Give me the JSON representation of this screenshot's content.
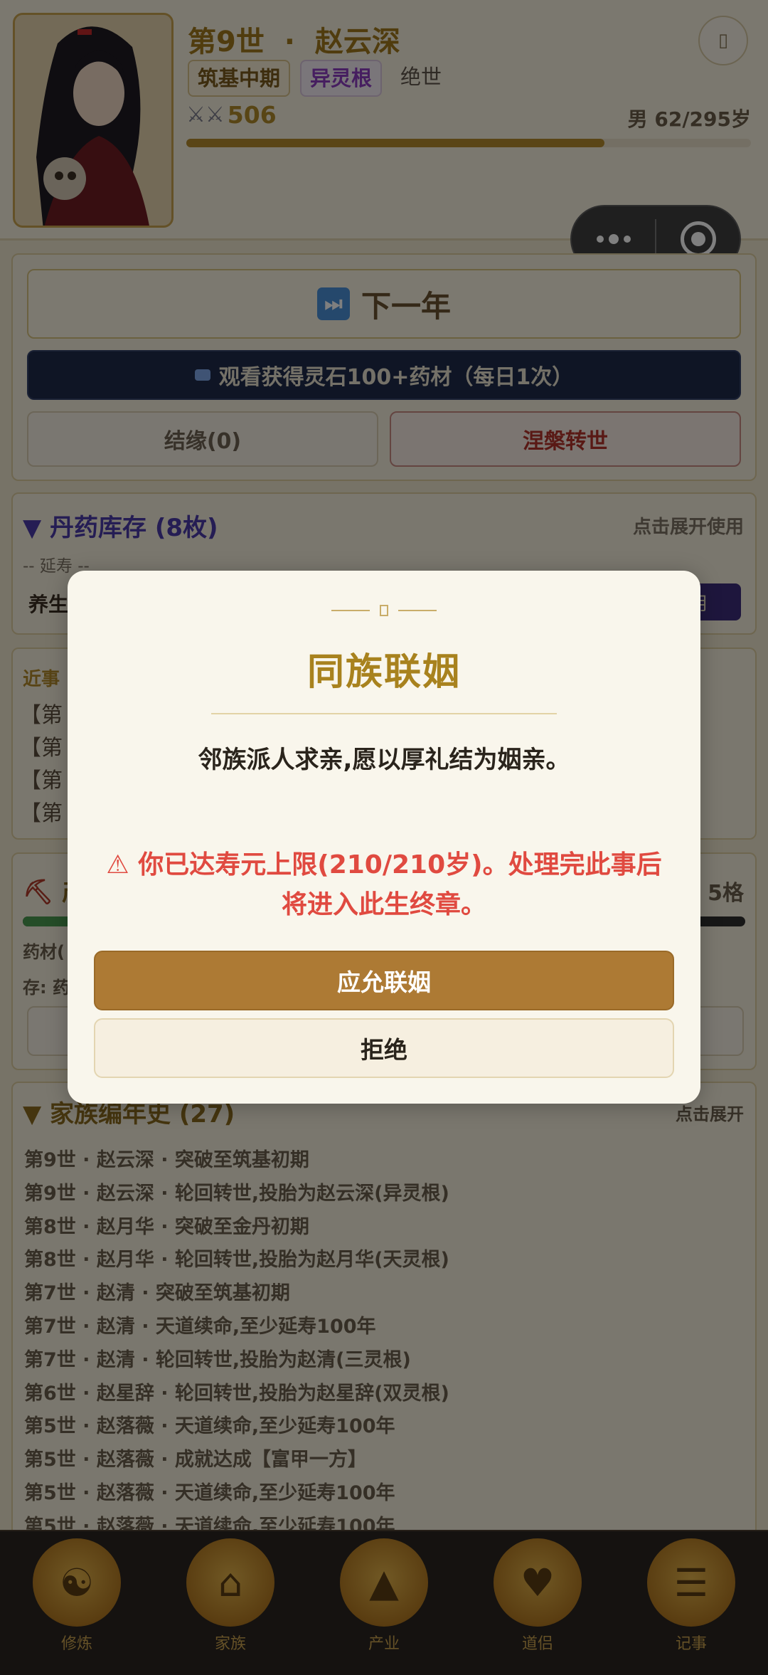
{
  "header": {
    "generation": "第9世",
    "separator": "·",
    "name": "赵云深",
    "tags": [
      "筑基中期",
      "异灵根",
      "绝世"
    ],
    "power": "506",
    "lifespan": "男 62/295岁",
    "life_fraction": 0.74,
    "circle_button_icon": "more-icon"
  },
  "actions": {
    "next_year": "下一年",
    "watch_ad": "观看获得灵石100+药材（每日1次）",
    "marriage": "结缘(0)",
    "reincarnate": "涅槃转世"
  },
  "pills": {
    "title": "▼ 丹药库存 (8枚)",
    "hint": "点击展开使用",
    "group": "-- 延寿 --",
    "item": "养生丹",
    "use_label": "用"
  },
  "events": {
    "title": "近事",
    "lines": [
      "【第",
      "【第",
      "【第",
      "【第"
    ]
  },
  "industry": {
    "title": "产",
    "slots": "5格",
    "line1": "药材(",
    "line2": "存: 药"
  },
  "chronicle": {
    "title": "▼ 家族编年史 (27)",
    "hint": "点击展开",
    "lines": [
      "第9世 · 赵云深 · 突破至筑基初期",
      "第9世 · 赵云深 · 轮回转世,投胎为赵云深(异灵根)",
      "第8世 · 赵月华 · 突破至金丹初期",
      "第8世 · 赵月华 · 轮回转世,投胎为赵月华(天灵根)",
      "第7世 · 赵清 · 突破至筑基初期",
      "第7世 · 赵清 · 天道续命,至少延寿100年",
      "第7世 · 赵清 · 轮回转世,投胎为赵清(三灵根)",
      "第6世 · 赵星辞 · 轮回转世,投胎为赵星辞(双灵根)",
      "第5世 · 赵落薇 · 天道续命,至少延寿100年",
      "第5世 · 赵落薇 · 成就达成【富甲一方】",
      "第5世 · 赵落薇 · 天道续命,至少延寿100年",
      "第5世 · 赵落薇 · 天道续命,至少延寿100年"
    ]
  },
  "nav": [
    {
      "label": "修炼",
      "icon": "meditation-icon"
    },
    {
      "label": "家族",
      "icon": "house-icon"
    },
    {
      "label": "产业",
      "icon": "mountain-icon"
    },
    {
      "label": "道侣",
      "icon": "couple-icon"
    },
    {
      "label": "记事",
      "icon": "scroll-icon"
    }
  ],
  "modal": {
    "title": "同族联姻",
    "text": "邻族派人求亲,愿以厚礼结为姻亲。",
    "warning_icon": "⚠",
    "warning_line1": "你已达寿元上限(210/210岁)。处理完此事后",
    "warning_line2": "将进入此生终章。",
    "accept": "应允联姻",
    "reject": "拒绝"
  },
  "colors": {
    "gold": "#a8821e",
    "warning": "#e04a40",
    "accept_bg": "#ad7a34",
    "pill_title": "#4a3aa8"
  }
}
